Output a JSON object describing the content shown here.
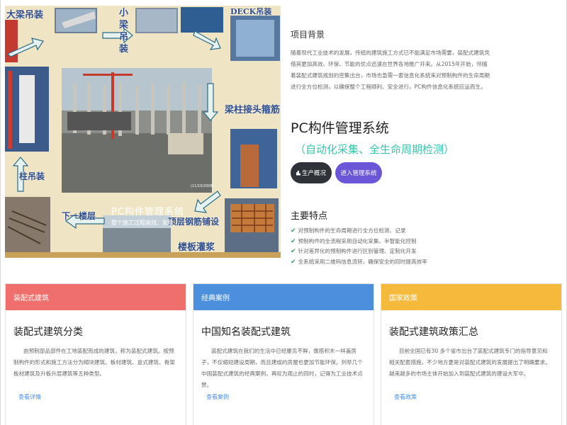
{
  "hero": {
    "labels": {
      "beam": "大梁吊装",
      "small_beam": "小梁吊装",
      "deck": "DECK吊装",
      "joint": "梁柱接头箍筋",
      "column": "柱吊装",
      "next_floor": "下一楼层",
      "rebar": "顶层钢筋铺设",
      "pour": "楼板灌浆"
    },
    "overlay_big": "PC构件管理系统",
    "overlay_small": "整个施工过程高效、安全",
    "photo_tag": "(11/10/2008)"
  },
  "background": {
    "title": "项目背景",
    "text": "随着现代工业技术的发展，传统的建筑施工方式已不能满足市场需要，装配式建筑凭借其更加高效、环保、节能的优点迅速在世界各地推广开来。从2015年开始，伴随着装配式建筑规划的密集出台，市场也急需一套信息化系统来对预制构件的生命周期进行全方位检测，以确保整个工程顺利、安全进行，PC构件信息化系统应运而生。"
  },
  "system": {
    "title": "PC构件管理系统",
    "subtitle": "（自动化采集、全生命周期检测）",
    "btn_production": "生产概况",
    "btn_enter": "进入管理系统"
  },
  "features": {
    "title": "主要特点",
    "items": [
      "对预制构件的生命周期进行全方位检测、记录",
      "预制构件的全流程采用自动化采集、半智能化控制",
      "针对差异化的预制构件进行区别管理、定制化开发",
      "全系统采用二维码信息流转，确保安全的同时提高效率"
    ]
  },
  "cards": [
    {
      "header": "装配式建筑",
      "title": "装配式建筑分类",
      "text": "由预制部品部件在工地装配而成的建筑，称为装配式建筑。按预制构件的形式和施工方法分为砌块建筑、板材建筑、盒式建筑、骨架板材建筑及升板升层建筑等五种类型。",
      "link": "查看详情"
    },
    {
      "header": "经典案例",
      "title": "中国知名装配式建筑",
      "text": "装配式建筑在我们的生活中已经屡见不鲜，像搭积木一样盖房子，不仅缩短建设周期，而且建成的房屋也更加节能环保。列举几个中国装配式建筑的经典案例，再叹为观止的同时，记得为工业技术点赞。",
      "link": "查看案例"
    },
    {
      "header": "国家政策",
      "title": "装配式建筑政策汇总",
      "text": "目前全国已有30 多个省市出台了装配式建筑专门的指导意见和相关配套措施，不少地方更是对装配式建筑的发展提出了明确要求。越来越多的市场主体开始加入到装配式建筑的建设大军中。",
      "link": "查看政策"
    }
  ],
  "colors": {
    "card1": "#ef6f6c",
    "card2": "#4b8fdd",
    "card3": "#f5b93b",
    "accent_teal": "#35c6ad",
    "purple": "#6b56d8",
    "dark": "#2f3238"
  }
}
